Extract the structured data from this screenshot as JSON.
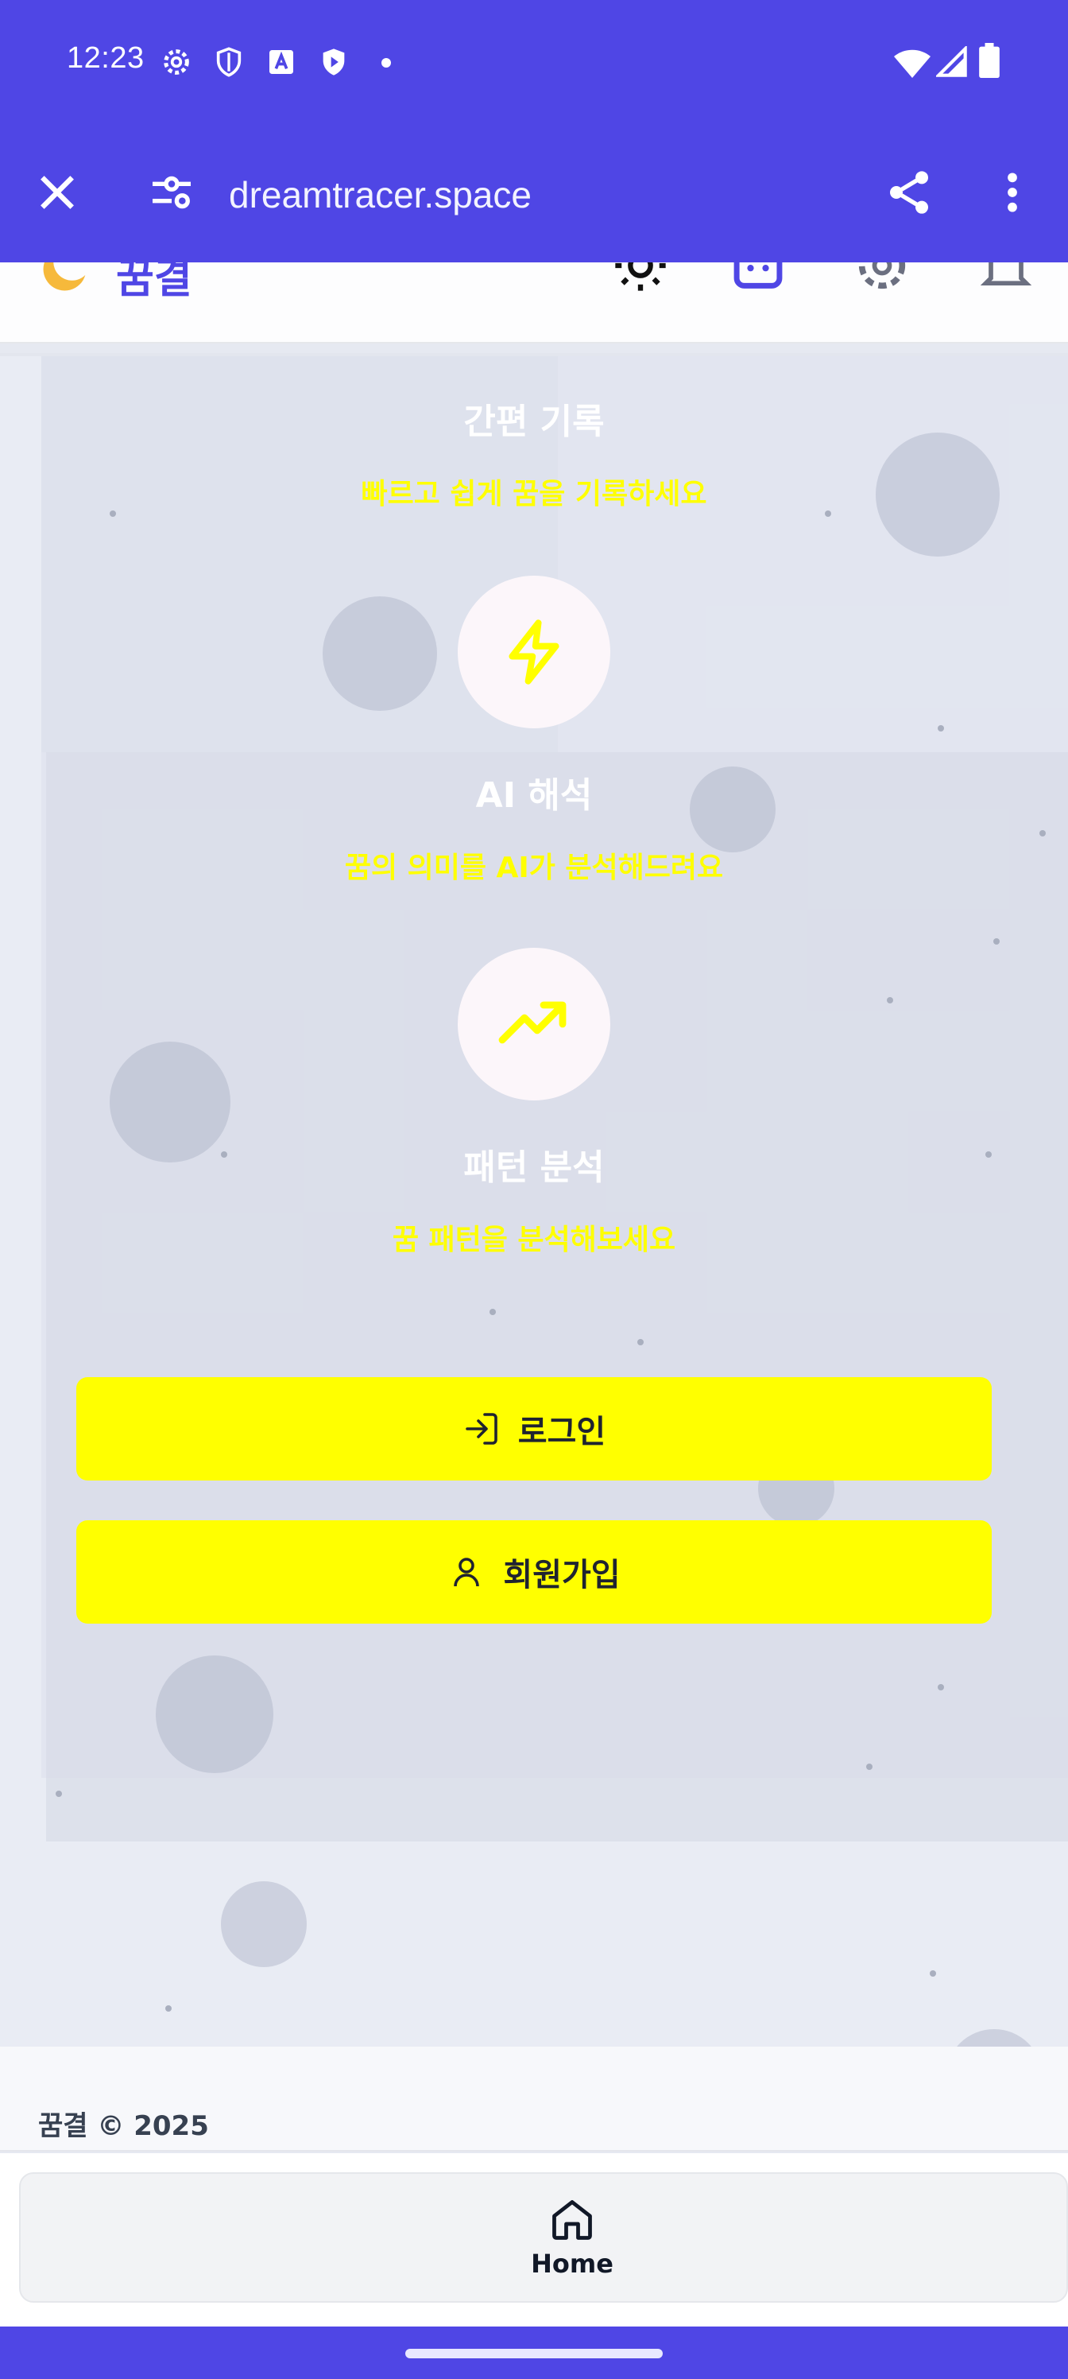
{
  "status_bar": {
    "time": "12:23",
    "left_icons": [
      "gear-icon",
      "shield-icon",
      "translate-icon",
      "play-shield-icon",
      "dot-icon"
    ],
    "right_icons": [
      "wifi-icon",
      "cell-signal-icon",
      "battery-icon"
    ]
  },
  "browser": {
    "url": "dreamtracer.space",
    "icons": [
      "close-icon",
      "site-settings-icon",
      "share-icon",
      "more-vert-icon"
    ]
  },
  "header": {
    "brand": "꿈결",
    "brand_icon": "moon-icon",
    "icons": [
      "sun-icon",
      "robot-icon",
      "settings-icon",
      "bell-icon"
    ]
  },
  "features": [
    {
      "title": "간편 기록",
      "description": "빠르고 쉽게 꿈을 기록하세요"
    },
    {
      "title": "AI 해석",
      "description": "꿈의 의미를 AI가 분석해드려요",
      "icon": "lightning-icon"
    },
    {
      "title": "패턴 분석",
      "description": "꿈 패턴을 분석해보세요",
      "icon": "trending-up-icon"
    }
  ],
  "actions": {
    "login_label": "로그인",
    "signup_label": "회원가입"
  },
  "footer": {
    "text": "꿈결  © 2025"
  },
  "bottom_nav": {
    "home_label": "Home"
  },
  "colors": {
    "accent": "#4f46e5",
    "button": "#ffff00",
    "feature_desc": "#ffff00"
  }
}
